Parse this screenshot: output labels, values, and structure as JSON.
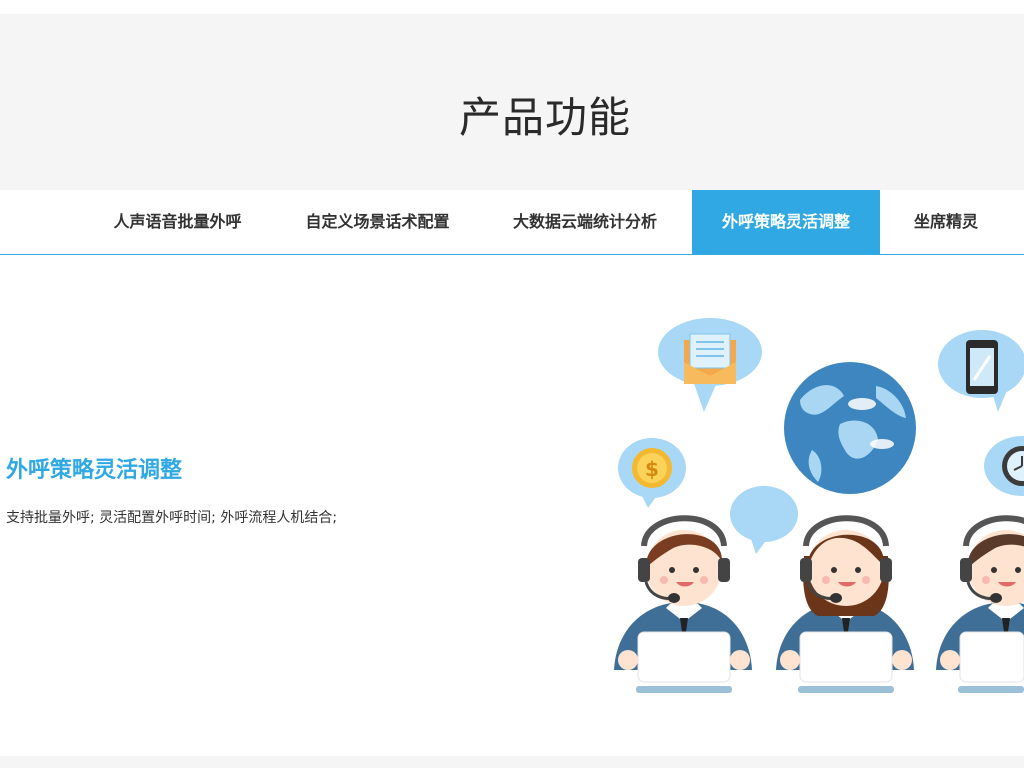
{
  "hero": {
    "title": "产品功能"
  },
  "tabs": [
    {
      "label": "人声语音批量外呼",
      "active": false
    },
    {
      "label": "自定义场景话术配置",
      "active": false
    },
    {
      "label": "大数据云端统计分析",
      "active": false
    },
    {
      "label": "外呼策略灵活调整",
      "active": true
    },
    {
      "label": "坐席精灵",
      "active": false
    }
  ],
  "content": {
    "title": "外呼策略灵活调整",
    "description": "支持批量外呼; 灵活配置外呼时间; 外呼流程人机结合;"
  },
  "colors": {
    "accent": "#2fa8e3",
    "hero_bg": "#f5f5f5",
    "text_dark": "#333333"
  },
  "illustration": {
    "icons": [
      "envelope-icon",
      "globe-icon",
      "smartphone-icon",
      "dollar-coin-icon",
      "clock-icon",
      "speech-bubble-icon",
      "call-center-agent-icon"
    ]
  }
}
